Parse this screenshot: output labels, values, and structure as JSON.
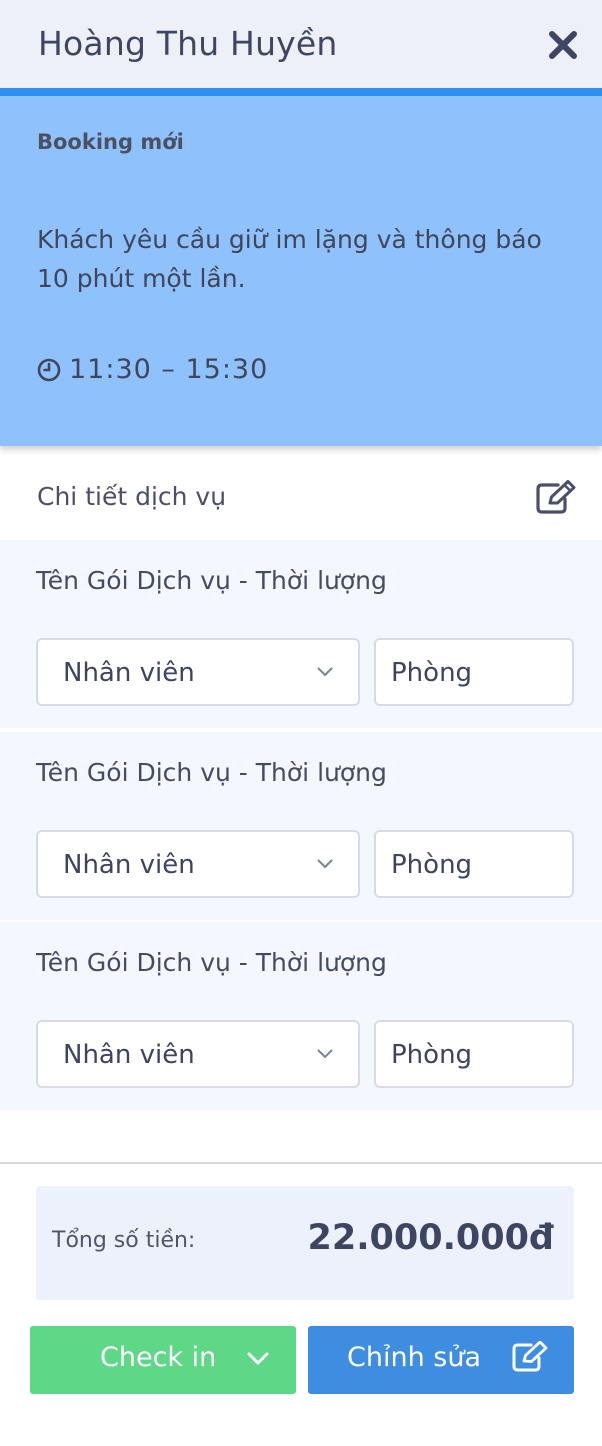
{
  "header": {
    "title": "Hoàng Thu Huyền",
    "close_icon": "close-icon"
  },
  "booking": {
    "status": "Booking mới",
    "note": "Khách yêu cầu giữ im lặng và thông báo 10 phút một lần.",
    "time": "11:30 – 15:30",
    "time_icon": "clock-icon"
  },
  "service_detail": {
    "title": "Chi tiết dịch vụ",
    "edit_icon": "edit-icon",
    "items": [
      {
        "name": "Tên Gói Dịch vụ - Thời lượng",
        "staff": "Nhân viên",
        "room": "Phòng"
      },
      {
        "name": "Tên Gói Dịch vụ - Thời lượng",
        "staff": "Nhân viên",
        "room": "Phòng"
      },
      {
        "name": "Tên Gói Dịch vụ - Thời lượng",
        "staff": "Nhân viên",
        "room": "Phòng"
      }
    ]
  },
  "total": {
    "label": "Tổng số tiền:",
    "value": "22.000.000đ"
  },
  "actions": {
    "checkin_label": "Check in",
    "edit_label": "Chỉnh sửa"
  },
  "colors": {
    "accent": "#2d8ff0",
    "card": "#8fc1fd",
    "checkin": "#5ed887",
    "edit": "#3f8de1"
  }
}
